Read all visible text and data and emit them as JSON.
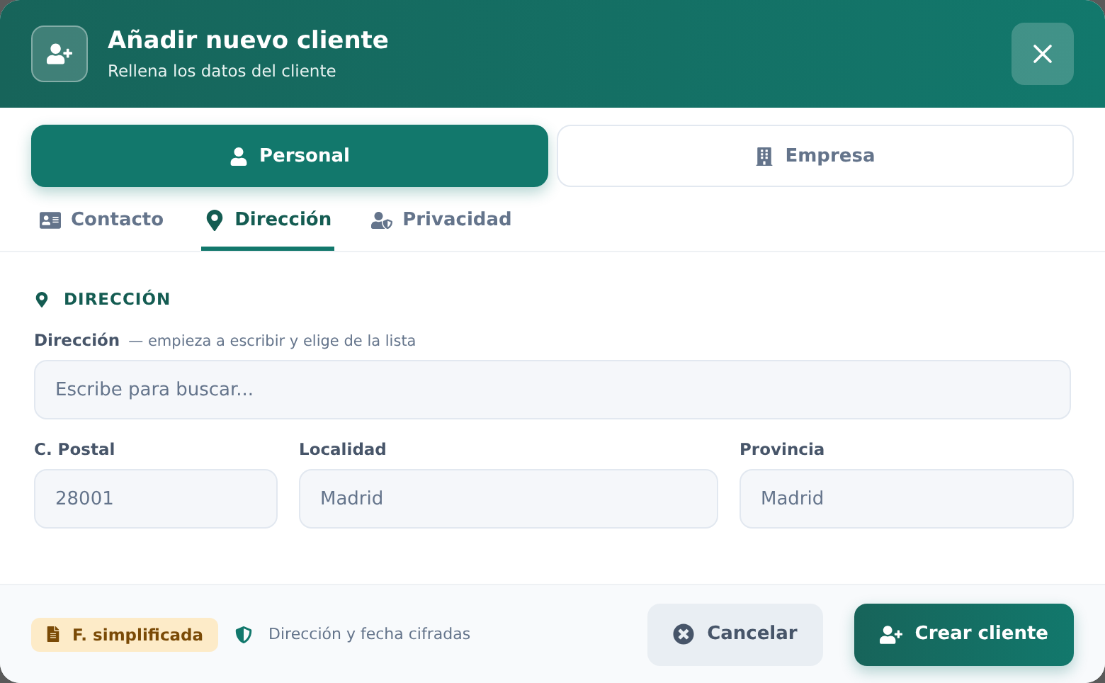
{
  "header": {
    "title": "Añadir nuevo cliente",
    "subtitle": "Rellena los datos del cliente"
  },
  "types": [
    {
      "label": "Personal",
      "selected": true
    },
    {
      "label": "Empresa",
      "selected": false
    }
  ],
  "tabs": [
    {
      "label": "Contacto",
      "selected": false
    },
    {
      "label": "Dirección",
      "selected": true
    },
    {
      "label": "Privacidad",
      "selected": false
    }
  ],
  "section": {
    "title": "DIRECCIÓN",
    "address_label": "Dirección",
    "address_hint": "— empieza a escribir y elige de la lista",
    "address_placeholder": "Escribe para buscar..."
  },
  "fields": [
    {
      "label": "C. Postal",
      "placeholder": "28001"
    },
    {
      "label": "Localidad",
      "placeholder": "Madrid"
    },
    {
      "label": "Provincia",
      "placeholder": "Madrid"
    }
  ],
  "footer": {
    "badge": "F. simplificada",
    "note": "Dirección y fecha cifradas",
    "cancel": "Cancelar",
    "create": "Crear cliente"
  }
}
